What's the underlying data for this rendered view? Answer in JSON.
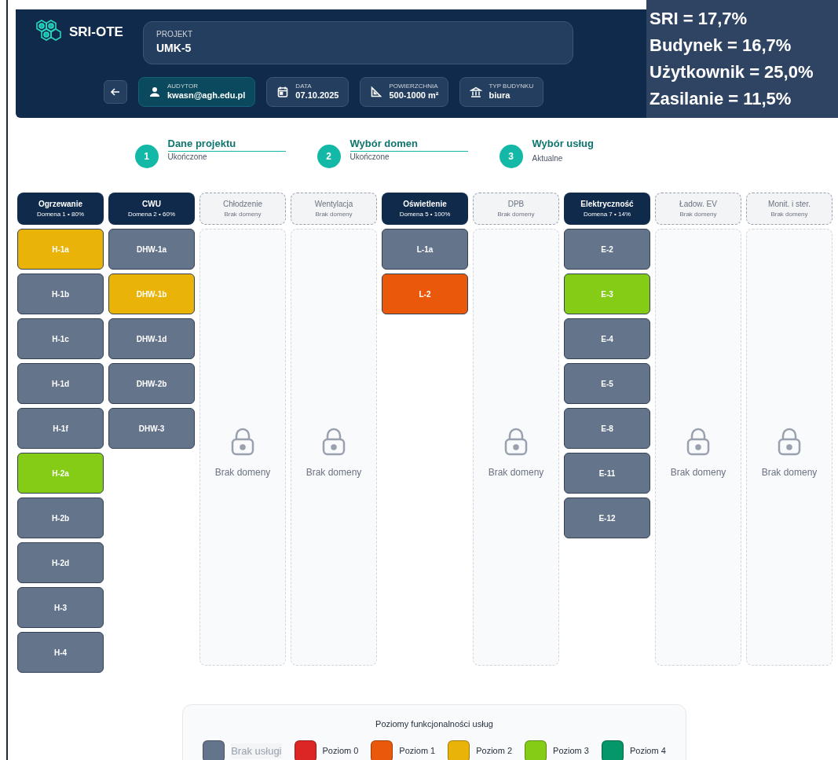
{
  "header": {
    "logo": "SRI-OTE",
    "project": {
      "label": "PROJEKT",
      "value": "UMK-5"
    },
    "info": [
      {
        "kind": "user",
        "label": "AUDYTOR",
        "value": "kwasn@agh.edu.pl",
        "highlighted": true
      },
      {
        "kind": "calendar",
        "label": "DATA",
        "value": "07.10.2025",
        "highlighted": false
      },
      {
        "kind": "area",
        "label": "POWIERZCHNIA",
        "value": "500-1000 m²",
        "highlighted": false
      },
      {
        "kind": "building",
        "label": "TYP BUDYNKU",
        "value": "biura",
        "highlighted": false
      }
    ]
  },
  "scores": [
    "SRI = 17,7%",
    "Budynek = 16,7%",
    "Użytkownik = 25,0%",
    "Zasilanie = 11,5%"
  ],
  "steps": [
    {
      "number": "1",
      "title": "Dane projektu",
      "status": "Ukończone",
      "completed": true
    },
    {
      "number": "2",
      "title": "Wybór domen",
      "status": "Ukończone",
      "completed": true
    },
    {
      "number": "3",
      "title": "Wybór usług",
      "status": "Aktualne",
      "completed": false
    }
  ],
  "domains": [
    {
      "name": "Ogrzewanie",
      "subtitle": "Domena 1 • 80%",
      "active": true,
      "services": [
        {
          "code": "H-1a",
          "color": "#eab308"
        },
        {
          "code": "H-1b",
          "color": "#64748b"
        },
        {
          "code": "H-1c",
          "color": "#64748b"
        },
        {
          "code": "H-1d",
          "color": "#64748b"
        },
        {
          "code": "H-1f",
          "color": "#64748b"
        },
        {
          "code": "H-2a",
          "color": "#84cc16"
        },
        {
          "code": "H-2b",
          "color": "#64748b"
        },
        {
          "code": "H-2d",
          "color": "#64748b"
        },
        {
          "code": "H-3",
          "color": "#64748b"
        },
        {
          "code": "H-4",
          "color": "#64748b"
        }
      ]
    },
    {
      "name": "CWU",
      "subtitle": "Domena 2 • 60%",
      "active": true,
      "services": [
        {
          "code": "DHW-1a",
          "color": "#64748b"
        },
        {
          "code": "DHW-1b",
          "color": "#eab308"
        },
        {
          "code": "DHW-1d",
          "color": "#64748b"
        },
        {
          "code": "DHW-2b",
          "color": "#64748b"
        },
        {
          "code": "DHW-3",
          "color": "#64748b"
        }
      ]
    },
    {
      "name": "Chłodzenie",
      "subtitle": "Brak domeny",
      "active": false,
      "empty_text": "Brak domeny"
    },
    {
      "name": "Wentylacja",
      "subtitle": "Brak domeny",
      "active": false,
      "empty_text": "Brak domeny"
    },
    {
      "name": "Oświetlenie",
      "subtitle": "Domena 5 • 100%",
      "active": true,
      "services": [
        {
          "code": "L-1a",
          "color": "#64748b"
        },
        {
          "code": "L-2",
          "color": "#ea580c"
        }
      ]
    },
    {
      "name": "DPB",
      "subtitle": "Brak domeny",
      "active": false,
      "empty_text": "Brak domeny"
    },
    {
      "name": "Elektryczność",
      "subtitle": "Domena 7 • 14%",
      "active": true,
      "services": [
        {
          "code": "E-2",
          "color": "#64748b"
        },
        {
          "code": "E-3",
          "color": "#84cc16"
        },
        {
          "code": "E-4",
          "color": "#64748b"
        },
        {
          "code": "E-5",
          "color": "#64748b"
        },
        {
          "code": "E-8",
          "color": "#64748b"
        },
        {
          "code": "E-11",
          "color": "#64748b"
        },
        {
          "code": "E-12",
          "color": "#64748b"
        }
      ]
    },
    {
      "name": "Ładow. EV",
      "subtitle": "Brak domeny",
      "active": false,
      "empty_text": "Brak domeny"
    },
    {
      "name": "Monit. i ster.",
      "subtitle": "Brak domeny",
      "active": false,
      "empty_text": "Brak domeny"
    }
  ],
  "legend": {
    "title": "Poziomy funkcjonalności usług",
    "items": [
      {
        "label": "Brak usługi",
        "color": "#64748b",
        "dimmed": true
      },
      {
        "label": "Poziom 0",
        "color": "#dc2626",
        "dimmed": false
      },
      {
        "label": "Poziom 1",
        "color": "#ea580c",
        "dimmed": false
      },
      {
        "label": "Poziom 2",
        "color": "#eab308",
        "dimmed": false
      },
      {
        "label": "Poziom 3",
        "color": "#84cc16",
        "dimmed": false
      },
      {
        "label": "Poziom 4",
        "color": "#059669",
        "dimmed": false
      }
    ]
  }
}
